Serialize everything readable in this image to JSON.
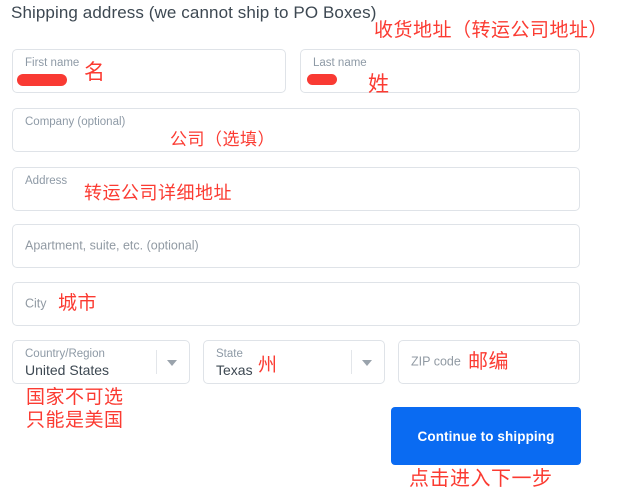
{
  "page": {
    "title": "Shipping address (we cannot ship to PO Boxes)",
    "background_color": "#ffffff",
    "accent_color": "#0a6bf2",
    "annotation_color": "#fb3b32",
    "border_color": "#dfe3e8",
    "label_color": "#8e9aa6",
    "value_color": "#3d4852"
  },
  "form": {
    "fields": [
      {
        "name": "first-name",
        "label": "First name",
        "value": "",
        "redacted": true,
        "annotation": "名"
      },
      {
        "name": "last-name",
        "label": "Last name",
        "value": "",
        "redacted": true,
        "annotation": "姓"
      },
      {
        "name": "company",
        "label": "Company (optional)",
        "value": "",
        "annotation": "公司（选填）"
      },
      {
        "name": "address",
        "label": "Address",
        "value": "",
        "annotation": "转运公司详细地址"
      },
      {
        "name": "apartment",
        "label": "Apartment, suite, etc. (optional)",
        "value": "",
        "annotation": ""
      },
      {
        "name": "city",
        "label": "City",
        "value": "",
        "annotation": "城市"
      }
    ],
    "country": {
      "label": "Country/Region",
      "value": "United States",
      "icon": "chevron-down-icon"
    },
    "state": {
      "label": "State",
      "value": "Texas",
      "icon": "chevron-down-icon",
      "annotation": "州"
    },
    "zip": {
      "label": "ZIP code",
      "value": "",
      "annotation": "邮编"
    }
  },
  "actions": {
    "continue_label": "Continue to shipping"
  },
  "annotations": {
    "header": "收货地址（转运公司地址）",
    "country_note": "国家不可选\n只能是美国",
    "button_note": "点击进入下一步"
  }
}
